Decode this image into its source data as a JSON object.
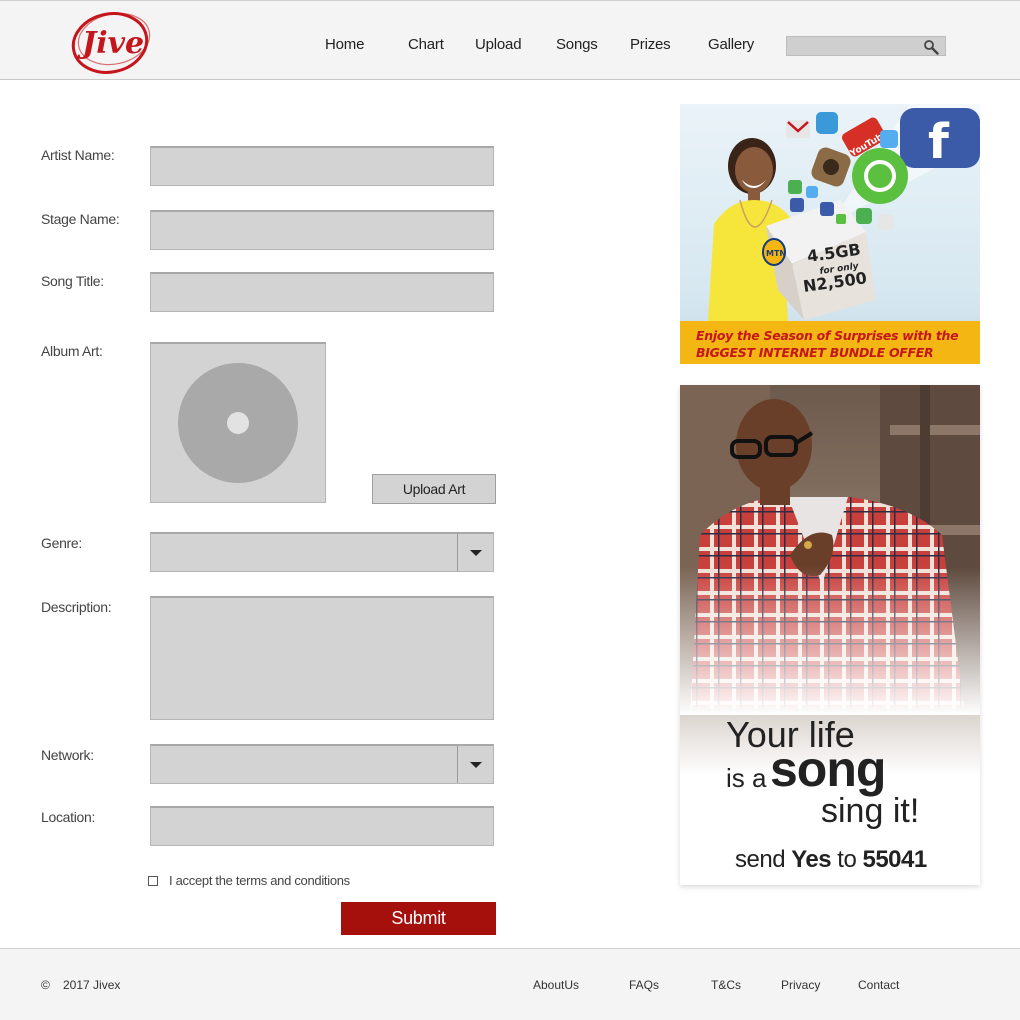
{
  "brand": {
    "logo_text": "Jive",
    "accent": "#c4161c"
  },
  "nav": {
    "items": [
      {
        "label": "Home"
      },
      {
        "label": "Chart"
      },
      {
        "label": "Upload"
      },
      {
        "label": "Songs"
      },
      {
        "label": "Prizes"
      },
      {
        "label": "Gallery"
      }
    ],
    "search": {
      "value": "",
      "placeholder": "",
      "icon": "search-icon"
    }
  },
  "form": {
    "artist_name": {
      "label": "Artist Name:",
      "value": ""
    },
    "stage_name": {
      "label": "Stage Name:",
      "value": ""
    },
    "song_title": {
      "label": "Song Title:",
      "value": ""
    },
    "album_art": {
      "label": "Album Art:",
      "upload_label": "Upload Art"
    },
    "genre": {
      "label": "Genre:",
      "value": ""
    },
    "description": {
      "label": "Description:",
      "value": ""
    },
    "network": {
      "label": "Network:",
      "value": ""
    },
    "location": {
      "label": "Location:",
      "value": ""
    },
    "terms_label": "I accept the terms and conditions",
    "submit_label": "Submit",
    "submit_color": "#a50f0c"
  },
  "ads": {
    "mtn": {
      "data_amount": "4.5GB",
      "for_only": "for only",
      "price": "N2,500",
      "brand": "MTN",
      "youtube": "YouTube",
      "banner_line1": "Enjoy the Season of Surprises with the",
      "banner_line2": "BIGGEST INTERNET BUNDLE OFFER"
    },
    "song": {
      "line1": "Your life",
      "line2_prefix": "is a",
      "line2_word": "song",
      "line3": "sing it!",
      "send": "send",
      "yes": "Yes",
      "to": "to",
      "number": "55041"
    }
  },
  "footer": {
    "copyright_symbol": "©",
    "copyright": "2017 Jivex",
    "links": [
      {
        "label": "AboutUs"
      },
      {
        "label": "FAQs"
      },
      {
        "label": "T&Cs"
      },
      {
        "label": "Privacy"
      },
      {
        "label": "Contact"
      }
    ]
  }
}
